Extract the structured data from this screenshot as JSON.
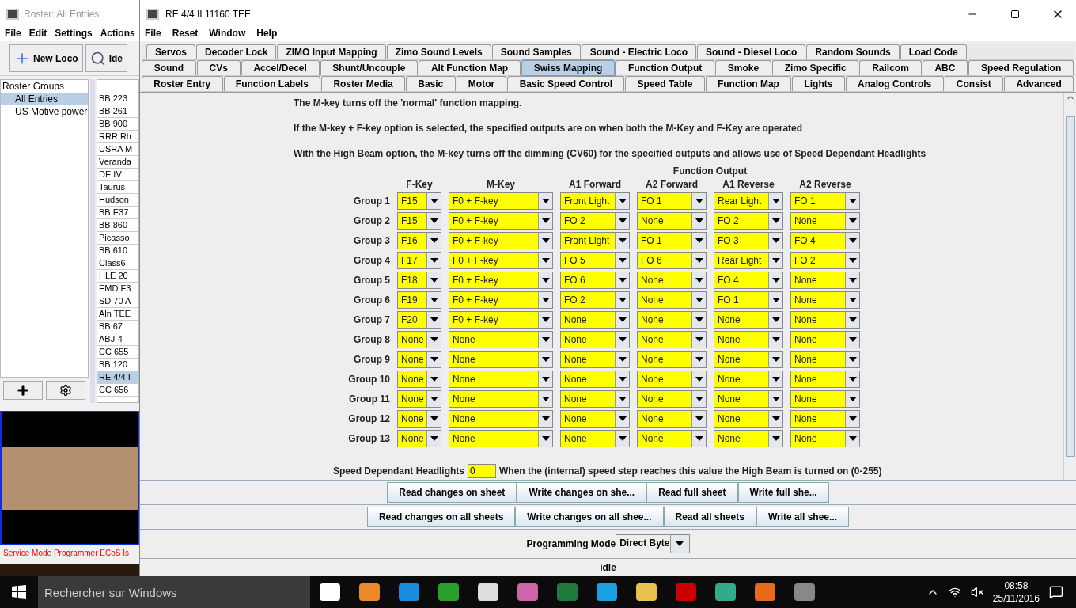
{
  "roster_window": {
    "title": "Roster: All Entries",
    "menu": [
      "File",
      "Edit",
      "Settings",
      "Actions"
    ],
    "toolbar": [
      {
        "label": "New Loco",
        "kind": "add"
      },
      {
        "label": "Ide",
        "kind": "search"
      }
    ],
    "groups_tree": {
      "title": "Roster Groups",
      "children": [
        {
          "label": "All Entries",
          "selected": true
        },
        {
          "label": "US Motive power",
          "selected": false
        }
      ]
    },
    "roster_list": [
      {
        "name": "BB 223",
        "selected": false
      },
      {
        "name": "BB 261",
        "selected": false
      },
      {
        "name": "BB 900",
        "selected": false
      },
      {
        "name": "RRR Rh",
        "selected": false
      },
      {
        "name": "USRA M",
        "selected": false
      },
      {
        "name": "Veranda",
        "selected": false
      },
      {
        "name": "DE IV",
        "selected": false
      },
      {
        "name": "Taurus",
        "selected": false
      },
      {
        "name": "Hudson",
        "selected": false
      },
      {
        "name": "BB E37",
        "selected": false
      },
      {
        "name": "BB 860",
        "selected": false
      },
      {
        "name": "Picasso",
        "selected": false
      },
      {
        "name": "BB 610",
        "selected": false
      },
      {
        "name": "Class6",
        "selected": false
      },
      {
        "name": "HLE 20",
        "selected": false
      },
      {
        "name": "EMD F3",
        "selected": false
      },
      {
        "name": "SD 70 A",
        "selected": false
      },
      {
        "name": "Aln TEE",
        "selected": false
      },
      {
        "name": "BB  67",
        "selected": false
      },
      {
        "name": "ABJ-4",
        "selected": false
      },
      {
        "name": "CC 655",
        "selected": false
      },
      {
        "name": "BB 120",
        "selected": false
      },
      {
        "name": "RE 4/4 I",
        "selected": true
      },
      {
        "name": "CC 656",
        "selected": false
      }
    ],
    "status": "Service Mode Programmer ECoS Is"
  },
  "window": {
    "title": "RE 4/4 II 11160 TEE",
    "menu": [
      "File",
      "Reset",
      "Window",
      "Help"
    ]
  },
  "tab_rows": [
    {
      "stretch": false,
      "tabs": [
        {
          "label": "Servos",
          "selected": false
        },
        {
          "label": "Decoder Lock",
          "selected": false
        },
        {
          "label": "ZIMO Input Mapping",
          "selected": false
        },
        {
          "label": "Zimo Sound Levels",
          "selected": false
        },
        {
          "label": "Sound Samples",
          "selected": false
        },
        {
          "label": "Sound - Electric Loco",
          "selected": false
        },
        {
          "label": "Sound - Diesel Loco",
          "selected": false
        },
        {
          "label": "Random Sounds",
          "selected": false
        },
        {
          "label": "Load Code",
          "selected": false
        }
      ]
    },
    {
      "stretch": true,
      "tabs": [
        {
          "label": "Sound",
          "selected": false
        },
        {
          "label": "CVs",
          "selected": false
        },
        {
          "label": "Accel/Decel",
          "selected": false
        },
        {
          "label": "Shunt/Uncouple",
          "selected": false
        },
        {
          "label": "Alt Function Map",
          "selected": false
        },
        {
          "label": "Swiss Mapping",
          "selected": true
        },
        {
          "label": "Function Output",
          "selected": false
        },
        {
          "label": "Smoke",
          "selected": false
        },
        {
          "label": "Zimo Specific",
          "selected": false
        },
        {
          "label": "Railcom",
          "selected": false
        },
        {
          "label": "ABC",
          "selected": false
        },
        {
          "label": "Speed Regulation",
          "selected": false
        }
      ]
    },
    {
      "stretch": true,
      "tabs": [
        {
          "label": "Roster Entry",
          "selected": false
        },
        {
          "label": "Function Labels",
          "selected": false
        },
        {
          "label": "Roster Media",
          "selected": false
        },
        {
          "label": "Basic",
          "selected": false
        },
        {
          "label": "Motor",
          "selected": false
        },
        {
          "label": "Basic Speed Control",
          "selected": false
        },
        {
          "label": "Speed Table",
          "selected": false
        },
        {
          "label": "Function Map",
          "selected": false
        },
        {
          "label": "Lights",
          "selected": false
        },
        {
          "label": "Analog Controls",
          "selected": false
        },
        {
          "label": "Consist",
          "selected": false
        },
        {
          "label": "Advanced",
          "selected": false
        }
      ]
    }
  ],
  "notes": [
    "The M-key turns off the 'normal' function mapping.",
    "If the M-key + F-key option is selected, the specified outputs are on when both the M-Key and F-Key are operated",
    "With the High Beam option, the M-key turns off the dimming (CV60) for the specified outputs and allows use of Speed Dependant Headlights"
  ],
  "mapping": {
    "heading": "Function Output",
    "columns": [
      "F-Key",
      "M-Key",
      "A1 Forward",
      "A2 Forward",
      "A1 Reverse",
      "A2 Reverse"
    ],
    "groups": [
      {
        "label": "Group  1",
        "values": [
          "F15",
          "F0 + F-key",
          "Front Light",
          "FO 1",
          "Rear Light",
          "FO 1"
        ]
      },
      {
        "label": "Group  2",
        "values": [
          "F15",
          "F0 + F-key",
          "FO 2",
          "None",
          "FO 2",
          "None"
        ]
      },
      {
        "label": "Group  3",
        "values": [
          "F16",
          "F0 + F-key",
          "Front Light",
          "FO 1",
          "FO 3",
          "FO 4"
        ]
      },
      {
        "label": "Group  4",
        "values": [
          "F17",
          "F0 + F-key",
          "FO 5",
          "FO 6",
          "Rear Light",
          "FO 2"
        ]
      },
      {
        "label": "Group  5",
        "values": [
          "F18",
          "F0 + F-key",
          "FO 6",
          "None",
          "FO 4",
          "None"
        ]
      },
      {
        "label": "Group  6",
        "values": [
          "F19",
          "F0 + F-key",
          "FO 2",
          "None",
          "FO 1",
          "None"
        ]
      },
      {
        "label": "Group  7",
        "values": [
          "F20",
          "F0 + F-key",
          "None",
          "None",
          "None",
          "None"
        ]
      },
      {
        "label": "Group  8",
        "values": [
          "None",
          "None",
          "None",
          "None",
          "None",
          "None"
        ]
      },
      {
        "label": "Group  9",
        "values": [
          "None",
          "None",
          "None",
          "None",
          "None",
          "None"
        ]
      },
      {
        "label": "Group 10",
        "values": [
          "None",
          "None",
          "None",
          "None",
          "None",
          "None"
        ]
      },
      {
        "label": "Group 11",
        "values": [
          "None",
          "None",
          "None",
          "None",
          "None",
          "None"
        ]
      },
      {
        "label": "Group 12",
        "values": [
          "None",
          "None",
          "None",
          "None",
          "None",
          "None"
        ]
      },
      {
        "label": "Group 13",
        "values": [
          "None",
          "None",
          "None",
          "None",
          "None",
          "None"
        ]
      }
    ]
  },
  "headlights": {
    "label": "Speed Dependant Headlights",
    "value": "0",
    "description": "When the (internal) speed step reaches this value the High Beam is turned on (0-255)"
  },
  "button_rows": [
    [
      "Read changes on sheet",
      "Write changes on she...",
      "Read full sheet",
      "Write full she..."
    ],
    [
      "Read changes on all sheets",
      "Write changes on all shee...",
      "Read all sheets",
      "Write all shee..."
    ]
  ],
  "programming_mode": {
    "label": "Programming Mode",
    "value": "Direct Byte"
  },
  "status": "idle",
  "taskbar": {
    "search_placeholder": "Rechercher sur Windows",
    "time": "08:58",
    "date": "25/11/2016"
  }
}
